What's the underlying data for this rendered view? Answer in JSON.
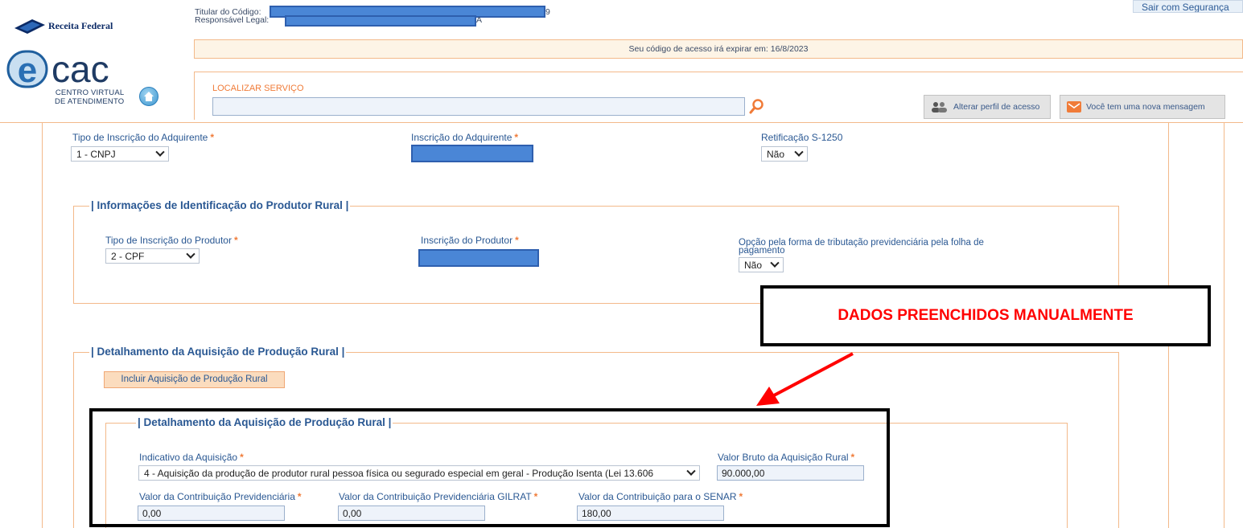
{
  "header": {
    "brand_text": "Receita Federal",
    "ecac_letters": "ecac",
    "ecac_subtitle_line1": "CENTRO VIRTUAL",
    "ecac_subtitle_line2": "DE ATENDIMENTO",
    "titular_label": "Titular do Código:",
    "responsavel_label": "Responsável Legal:",
    "titular_tail": "9",
    "responsavel_tail": "A",
    "logout_label": "Sair com Segurança",
    "expire_notice": "Seu código de acesso irá expirar em: 16/8/2023",
    "search_label": "LOCALIZAR SERVIÇO",
    "search_value": "",
    "profile_button": "Alterar perfil de acesso",
    "message_button": "Você tem uma nova mensagem"
  },
  "form": {
    "tipo_inscricao_adquirente": {
      "label": "Tipo de Inscrição do Adquirente",
      "value": "1 - CNPJ"
    },
    "inscricao_adquirente": {
      "label": "Inscrição do Adquirente"
    },
    "retificacao": {
      "label": "Retificação S-1250",
      "value": "Não"
    },
    "produtor_section": {
      "legend": "| Informações de Identificação do Produtor Rural |",
      "tipo_inscricao_produtor": {
        "label": "Tipo de Inscrição do Produtor",
        "value": "2 - CPF"
      },
      "inscricao_produtor": {
        "label": "Inscrição do Produtor"
      },
      "opcao_tributacao": {
        "label_line1": "Opção pela forma de tributação previdenciária pela folha de",
        "label_line2": "pagamento",
        "value": "Não"
      }
    },
    "aquisicao_section": {
      "legend": "| Detalhamento da Aquisição de Produção Rural |",
      "add_button": "Incluir Aquisição de Produção Rural",
      "detail": {
        "legend": "| Detalhamento da Aquisição de Produção Rural |",
        "indicativo": {
          "label": "Indicativo da Aquisição",
          "value": "4 - Aquisição da produção de produtor rural pessoa física ou segurado especial em geral - Produção Isenta (Lei 13.606"
        },
        "valor_bruto": {
          "label": "Valor Bruto da Aquisição Rural",
          "value": "90.000,00"
        },
        "valor_contrib_prev": {
          "label": "Valor da Contribuição Previdenciária",
          "value": "0,00"
        },
        "valor_gilrat": {
          "label": "Valor da Contribuição Previdenciária GILRAT",
          "value": "0,00"
        },
        "valor_senar": {
          "label": "Valor da Contribuição para o SENAR",
          "value": "180,00"
        }
      }
    }
  },
  "annotation": {
    "text": "DADOS PREENCHIDOS MANUALMENTE",
    "text_color": "#ff0000"
  },
  "colors": {
    "accent_orange": "#f07b38",
    "border_orange": "#f3b98a",
    "label_blue": "#2a5893",
    "redaction_blue": "#4a86d6"
  },
  "icons": [
    "receita-federal-logo-icon",
    "home-icon",
    "search-icon",
    "users-icon",
    "mail-icon",
    "chevron-down-icon",
    "arrow-icon"
  ]
}
